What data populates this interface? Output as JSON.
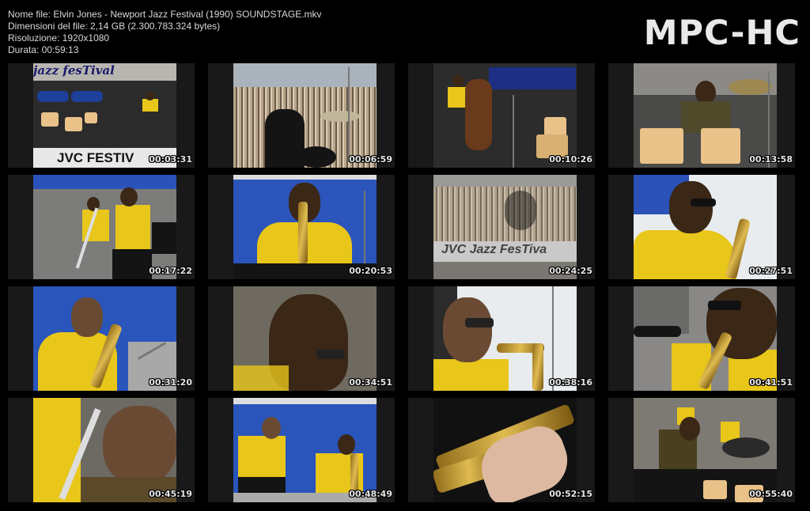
{
  "info": {
    "filename": "Nome file: Elvin Jones - Newport Jazz Festival (1990) SOUNDSTAGE.mkv",
    "filesize": "Dimensioni del file: 2,14 GB (2.300.783.324 bytes)",
    "resolution": "Risoluzione: 1920x1080",
    "duration": "Durata: 00:59:13"
  },
  "logo": "MPC-HC",
  "thumbs": [
    {
      "time": "00:03:31",
      "banner": "jazz fesTival",
      "banner2": "JVC FESTIV"
    },
    {
      "time": "00:06:59"
    },
    {
      "time": "00:10:26"
    },
    {
      "time": "00:13:58"
    },
    {
      "time": "00:17:22"
    },
    {
      "time": "00:20:53"
    },
    {
      "time": "00:24:25",
      "banner": "JVC Jazz FesTiva"
    },
    {
      "time": "00:27:51"
    },
    {
      "time": "00:31:20"
    },
    {
      "time": "00:34:51"
    },
    {
      "time": "00:38:16"
    },
    {
      "time": "00:41:51"
    },
    {
      "time": "00:45:19"
    },
    {
      "time": "00:48:49"
    },
    {
      "time": "00:52:15"
    },
    {
      "time": "00:55:40"
    }
  ]
}
